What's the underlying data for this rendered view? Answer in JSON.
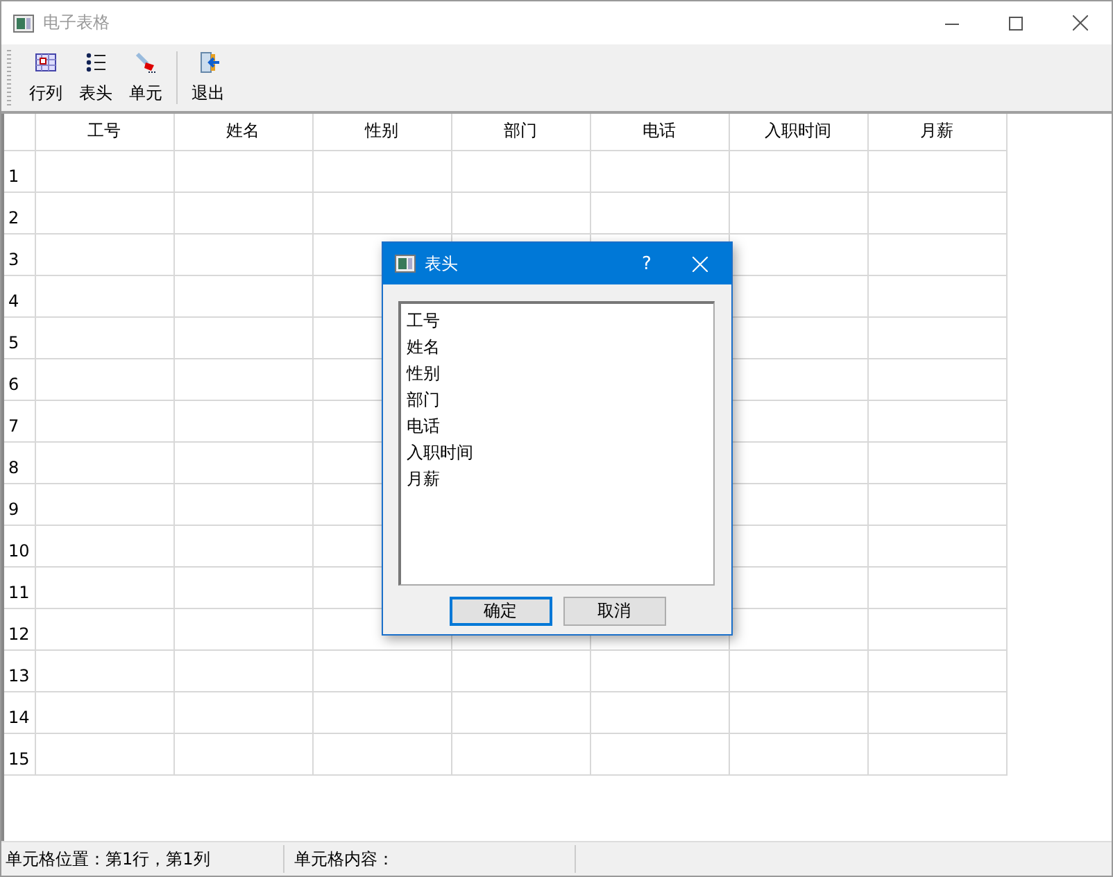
{
  "window": {
    "title": "电子表格",
    "active": false
  },
  "toolbar": {
    "groups": [
      [
        {
          "label": "行列",
          "kind": "grid"
        },
        {
          "label": "表头",
          "kind": "list"
        },
        {
          "label": "单元",
          "kind": "brush"
        }
      ],
      [
        {
          "label": "退出",
          "kind": "exit"
        }
      ]
    ]
  },
  "table": {
    "columns": [
      "工号",
      "姓名",
      "性别",
      "部门",
      "电话",
      "入职时间",
      "月薪"
    ],
    "row_headers": [
      "1",
      "2",
      "3",
      "4",
      "5",
      "6",
      "7",
      "8",
      "9",
      "10",
      "11",
      "12",
      "13",
      "14",
      "15"
    ]
  },
  "dialog": {
    "title": "表头",
    "help": "?",
    "items": [
      "工号",
      "姓名",
      "性别",
      "部门",
      "电话",
      "入职时间",
      "月薪"
    ],
    "buttons": [
      {
        "label": "确定",
        "default": true
      },
      {
        "label": "取消",
        "default": false
      }
    ]
  },
  "status_bar": [
    "单元格位置：第1行，第1列",
    "单元格内容："
  ]
}
